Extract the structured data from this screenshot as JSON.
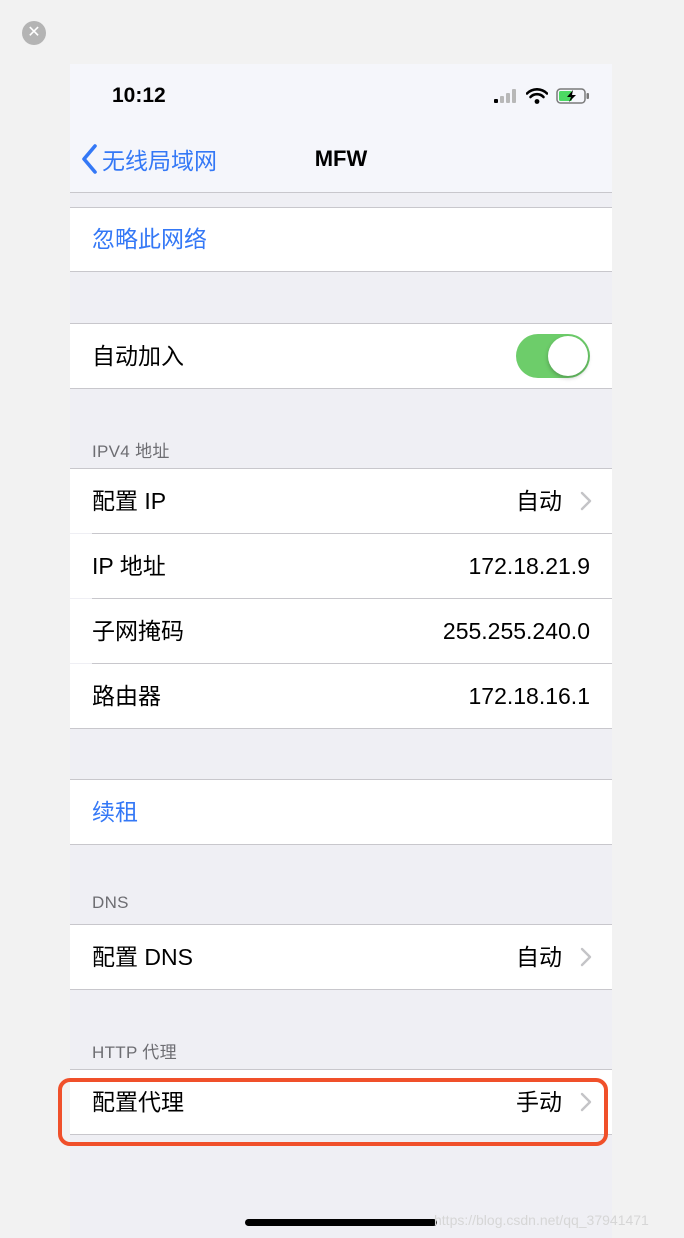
{
  "status_bar": {
    "time": "10:12"
  },
  "nav": {
    "back_label": "无线局域网",
    "title": "MFW"
  },
  "forget": {
    "label": "忽略此网络"
  },
  "auto_join": {
    "label": "自动加入",
    "enabled": true
  },
  "ipv4": {
    "header": "IPV4 地址",
    "rows": [
      {
        "label": "配置 IP",
        "value": "自动"
      },
      {
        "label": "IP 地址",
        "value": "172.18.21.9"
      },
      {
        "label": "子网掩码",
        "value": "255.255.240.0"
      },
      {
        "label": "路由器",
        "value": "172.18.16.1"
      }
    ]
  },
  "renew": {
    "label": "续租"
  },
  "dns": {
    "header": "DNS",
    "label": "配置 DNS",
    "value": "自动"
  },
  "http_proxy": {
    "header": "HTTP 代理",
    "label": "配置代理",
    "value": "手动"
  },
  "watermark": "https://blog.csdn.net/qq_37941471",
  "colors": {
    "accent": "#3478f6",
    "toggle_on": "#6dcd6a",
    "highlight": "#f0502a",
    "group_bg": "#efeff4"
  }
}
